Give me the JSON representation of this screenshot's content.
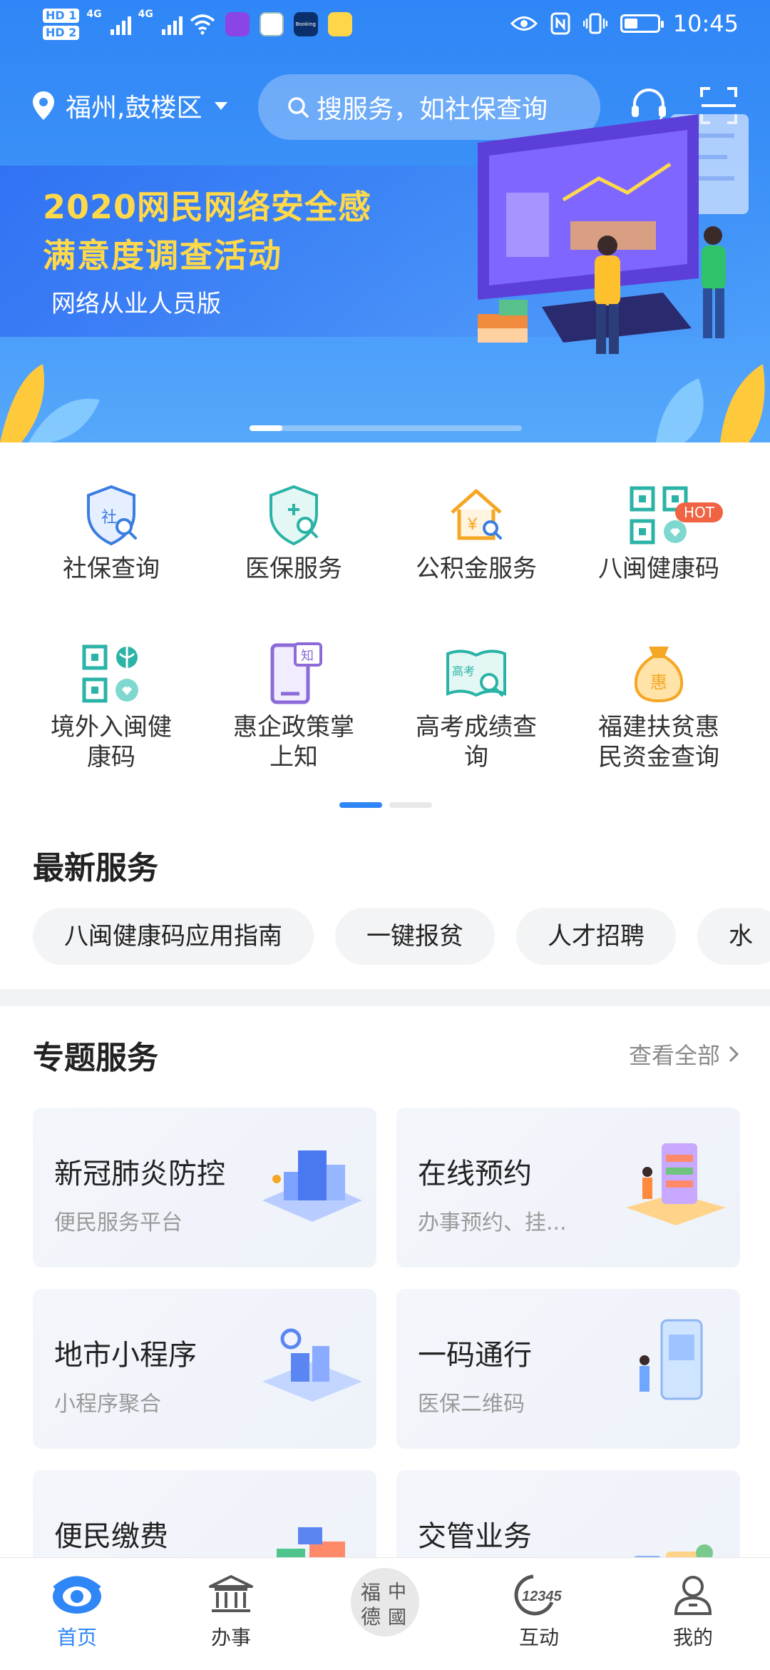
{
  "status_bar": {
    "hd1": "HD 1",
    "hd2": "HD 2",
    "net1": "4G",
    "net2": "4G",
    "time": "10:45",
    "app_icons": [
      "video-app-icon",
      "music-app-icon",
      "booking-app-icon",
      "message-app-icon"
    ],
    "booking_label": "Booking"
  },
  "header": {
    "location": "福州,鼓楼区",
    "search_placeholder": "搜服务，如社保查询",
    "support_icon": "headset-icon",
    "scan_icon": "scan-icon"
  },
  "banner": {
    "title_line1": "2020网民网络安全感",
    "title_line2": "满意度调查活动",
    "subtitle": "网络从业人员版",
    "slide_index": 1
  },
  "services": [
    {
      "label": "社保查询",
      "icon": "social-security-icon"
    },
    {
      "label": "医保服务",
      "icon": "medical-insurance-icon"
    },
    {
      "label": "公积金服务",
      "icon": "housing-fund-icon"
    },
    {
      "label": "八闽健康码",
      "icon": "health-code-icon",
      "badge": "HOT"
    },
    {
      "label": "境外入闽健\n康码",
      "icon": "overseas-health-code-icon"
    },
    {
      "label": "惠企政策掌\n上知",
      "icon": "policy-icon",
      "icon_text": "知"
    },
    {
      "label": "高考成绩查\n询",
      "icon": "exam-score-icon",
      "icon_text": "高考"
    },
    {
      "label": "福建扶贫惠\n民资金查询",
      "icon": "poverty-fund-icon",
      "icon_text": "惠"
    }
  ],
  "latest": {
    "title": "最新服务",
    "chips": [
      "八闽健康码应用指南",
      "一键报贫",
      "人才招聘",
      "水"
    ]
  },
  "topics": {
    "title": "专题服务",
    "see_all": "查看全部",
    "cards": [
      {
        "title": "新冠肺炎防控",
        "subtitle": "便民服务平台"
      },
      {
        "title": "在线预约",
        "subtitle": "办事预约、挂..."
      },
      {
        "title": "地市小程序",
        "subtitle": "小程序聚合"
      },
      {
        "title": "一码通行",
        "subtitle": "医保二维码"
      },
      {
        "title": "便民缴费",
        "subtitle": ""
      },
      {
        "title": "交管业务",
        "subtitle": ""
      }
    ]
  },
  "nav": {
    "items": [
      {
        "label": "首页",
        "icon": "home-eye-icon",
        "active": true
      },
      {
        "label": "办事",
        "icon": "government-building-icon"
      },
      {
        "label": "",
        "icon": "fude-china-seal-icon",
        "seal_text": [
          "福",
          "中",
          "德",
          "國"
        ]
      },
      {
        "label": "互动",
        "icon": "hotline-12345-icon",
        "icon_text": "12345"
      },
      {
        "label": "我的",
        "icon": "user-icon"
      }
    ]
  },
  "colors": {
    "primary": "#2f86f6",
    "banner_title": "#ffd94a",
    "hot_badge": "#f06343",
    "icon_blue": "#3b7de0",
    "icon_teal": "#2ab3a6",
    "icon_orange": "#f5a623",
    "icon_purple": "#8c6bd8"
  }
}
